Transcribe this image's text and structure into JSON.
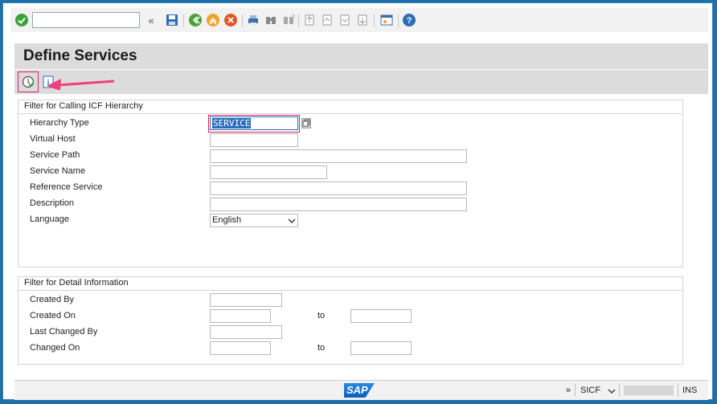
{
  "toolbar": {
    "command_field_value": "",
    "icons": [
      "check-icon",
      "collapse-icon",
      "save-icon",
      "back-icon",
      "exit-icon",
      "cancel-icon",
      "print-icon",
      "find-icon",
      "find-next-icon",
      "first-page-icon",
      "previous-page-icon",
      "next-page-icon",
      "last-page-icon",
      "new-session-icon",
      "help-icon"
    ]
  },
  "page": {
    "title": "Define Services"
  },
  "app_toolbar": {
    "icons": [
      "execute-icon",
      "information-icon"
    ]
  },
  "filter_hierarchy": {
    "title": "Filter for Calling ICF Hierarchy",
    "hierarchy_type_label": "Hierarchy Type",
    "hierarchy_type_value": "SERVICE",
    "virtual_host_label": "Virtual Host",
    "service_path_label": "Service Path",
    "service_name_label": "Service Name",
    "reference_service_label": "Reference Service",
    "description_label": "Description",
    "language_label": "Language",
    "language_value": "English"
  },
  "filter_detail": {
    "title": "Filter for Detail Information",
    "created_by_label": "Created By",
    "created_on_label": "Created On",
    "created_to_label": "to",
    "last_changed_by_label": "Last Changed By",
    "changed_on_label": "Changed On",
    "changed_to_label": "to"
  },
  "status_bar": {
    "logo_text": "SAP",
    "expand_symbol": "»",
    "transaction": "SICF",
    "mode": "INS"
  },
  "colors": {
    "highlight": "#e0245e",
    "selection": "#2a6ebd",
    "sap_blue": "#0a6ed1"
  }
}
